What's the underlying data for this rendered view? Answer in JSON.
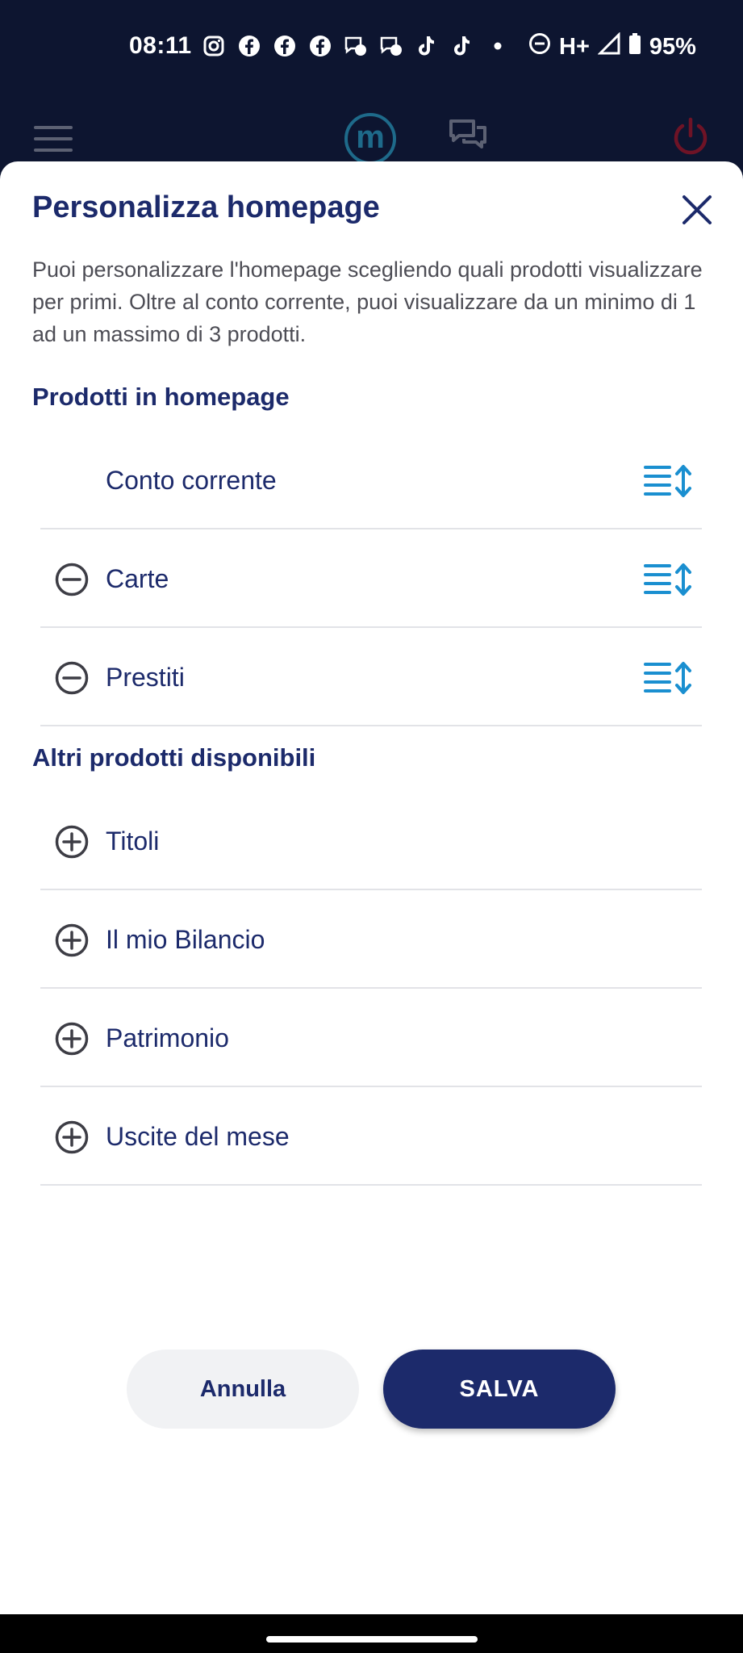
{
  "status_bar": {
    "time": "08:11",
    "network": "H+",
    "battery": "95%",
    "app_icons": [
      "instagram-icon",
      "facebook-icon",
      "facebook-icon",
      "facebook-icon",
      "messenger-icon",
      "messenger-icon",
      "tiktok-icon",
      "tiktok-icon",
      "dot-icon"
    ]
  },
  "header": {
    "logo_letter": "m"
  },
  "sheet": {
    "title": "Personalizza homepage",
    "description": "Puoi personalizzare l'homepage scegliendo quali prodotti visualizzare per primi. Oltre al conto corrente, puoi visualizzare da un minimo di 1 ad un massimo di 3 prodotti.",
    "home_section_title": "Prodotti in homepage",
    "home_products": [
      {
        "label": "Conto corrente",
        "removable": false
      },
      {
        "label": "Carte",
        "removable": true
      },
      {
        "label": "Prestiti",
        "removable": true
      }
    ],
    "other_section_title": "Altri prodotti disponibili",
    "other_products": [
      {
        "label": "Titoli"
      },
      {
        "label": "Il mio Bilancio"
      },
      {
        "label": "Patrimonio"
      },
      {
        "label": "Uscite del mese"
      }
    ],
    "cancel_label": "Annulla",
    "save_label": "SALVA"
  },
  "colors": {
    "primary": "#1c2a6b",
    "accent": "#1a8fd0",
    "danger": "#c0142b"
  }
}
